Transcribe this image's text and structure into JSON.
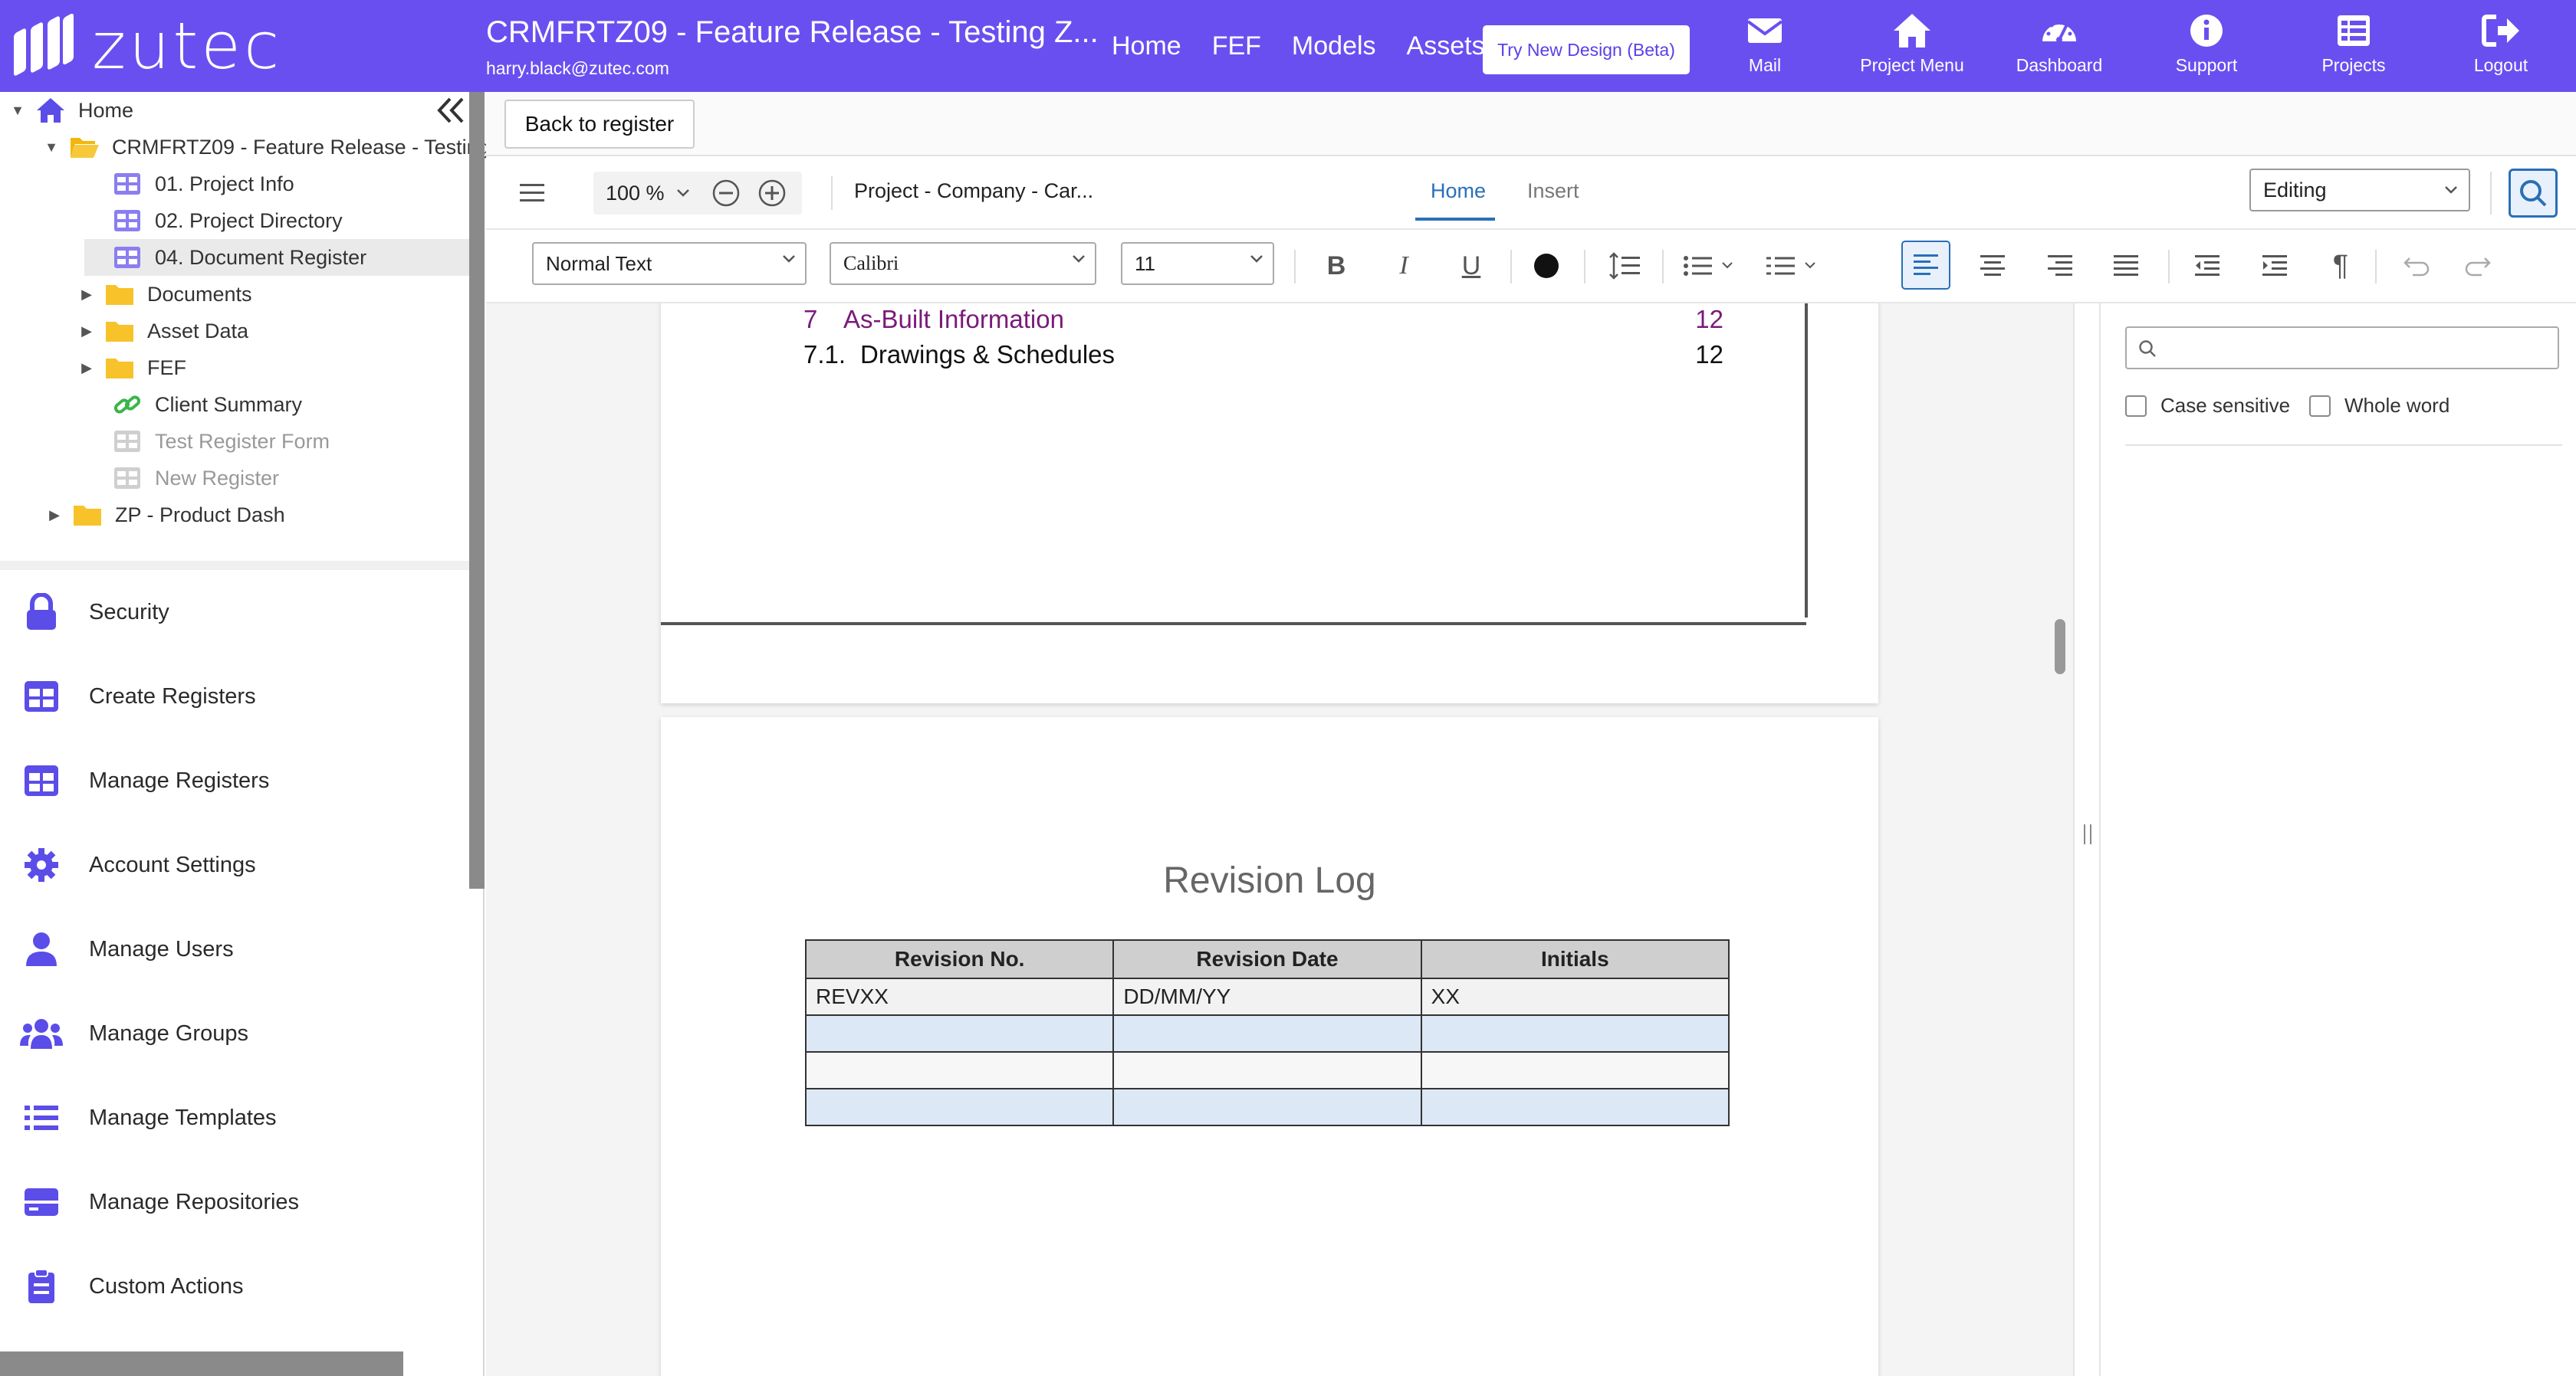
{
  "header": {
    "brand": "zutec",
    "project_title": "CRMFRTZ09 - Feature Release - Testing Z...",
    "user_email": "harry.black@zutec.com",
    "nav": [
      "Home",
      "FEF",
      "Models",
      "Assets"
    ],
    "beta_button": "Try New Design (Beta)",
    "icons": [
      {
        "label": "Mail",
        "icon": "mail-icon"
      },
      {
        "label": "Project Menu",
        "icon": "home-icon"
      },
      {
        "label": "Dashboard",
        "icon": "dashboard-icon"
      },
      {
        "label": "Support",
        "icon": "info-icon"
      },
      {
        "label": "Projects",
        "icon": "projects-icon"
      },
      {
        "label": "Logout",
        "icon": "logout-icon"
      }
    ],
    "brand_color": "#6a4ff0"
  },
  "sidebar": {
    "tree": [
      {
        "label": "Home",
        "icon": "home-icon",
        "level": 0,
        "caret": "down"
      },
      {
        "label": "CRMFRTZ09 - Feature Release - Testing",
        "icon": "folder-open-icon",
        "level": 1,
        "caret": "down"
      },
      {
        "label": "01. Project Info",
        "icon": "register-icon",
        "level": 2
      },
      {
        "label": "02. Project Directory",
        "icon": "register-icon",
        "level": 2
      },
      {
        "label": "04. Document Register",
        "icon": "register-icon",
        "level": 2,
        "selected": true
      },
      {
        "label": "Documents",
        "icon": "folder-icon",
        "level": 2,
        "caret": "right"
      },
      {
        "label": "Asset Data",
        "icon": "folder-icon",
        "level": 2,
        "caret": "right"
      },
      {
        "label": "FEF",
        "icon": "folder-icon",
        "level": 2,
        "caret": "right"
      },
      {
        "label": "Client Summary",
        "icon": "link-icon",
        "level": 2
      },
      {
        "label": "Test Register Form",
        "icon": "register-icon",
        "level": 2,
        "muted": true
      },
      {
        "label": "New Register",
        "icon": "register-icon",
        "level": 2,
        "muted": true
      },
      {
        "label": "ZP - Product Dash",
        "icon": "folder-icon",
        "level": 1,
        "caret": "right"
      }
    ],
    "menu": [
      {
        "label": "Security",
        "icon": "lock-icon"
      },
      {
        "label": "Create Registers",
        "icon": "table-icon"
      },
      {
        "label": "Manage Registers",
        "icon": "table-icon"
      },
      {
        "label": "Account Settings",
        "icon": "gear-icon"
      },
      {
        "label": "Manage Users",
        "icon": "user-icon"
      },
      {
        "label": "Manage Groups",
        "icon": "users-icon"
      },
      {
        "label": "Manage Templates",
        "icon": "list-icon"
      },
      {
        "label": "Manage Repositories",
        "icon": "repository-icon"
      },
      {
        "label": "Custom Actions",
        "icon": "clipboard-icon"
      }
    ]
  },
  "main": {
    "back_button": "Back to register",
    "toolbar": {
      "zoom": "100 %",
      "doc_name": "Project - Company - Car...",
      "tabs": [
        "Home",
        "Insert"
      ],
      "active_tab": "Home",
      "mode": "Editing",
      "style": "Normal Text",
      "font": "Calibri",
      "size": "11"
    },
    "document": {
      "toc": [
        {
          "num": "7",
          "title": "As-Built Information",
          "page": "12",
          "color": "#7a1a7a"
        },
        {
          "num": "7.1.",
          "title": "Drawings & Schedules",
          "page": "12",
          "color": "#111111"
        }
      ],
      "revision_title": "Revision Log",
      "revision_table": {
        "headers": [
          "Revision No.",
          "Revision Date",
          "Initials"
        ],
        "rows": [
          [
            "REVXX",
            "DD/MM/YY",
            "XX"
          ],
          [
            "",
            "",
            ""
          ],
          [
            "",
            "",
            ""
          ],
          [
            "",
            "",
            ""
          ]
        ]
      }
    },
    "find": {
      "placeholder": "",
      "case_sensitive": "Case sensitive",
      "whole_word": "Whole word"
    }
  }
}
